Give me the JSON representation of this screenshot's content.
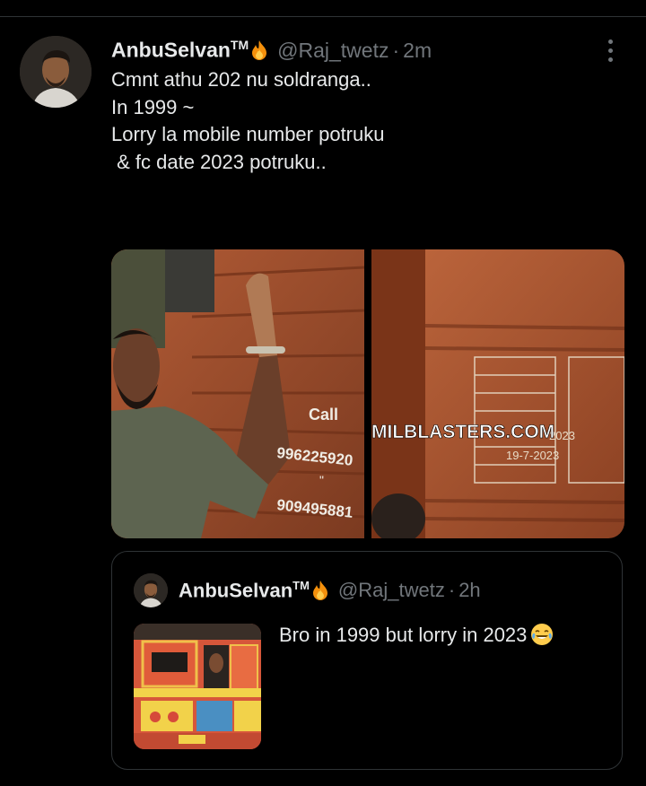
{
  "tweet": {
    "display_name": "AnbuSelvan",
    "trademark": "TM",
    "handle": "@Raj_twetz",
    "separator": "·",
    "time": "2m",
    "text_lines": [
      "Cmnt athu 202 nu soldranga..",
      "",
      "In 1999 ~",
      "",
      "Lorry la mobile number potruku",
      " & fc date 2023 potruku.."
    ],
    "icons": {
      "badge": "fire-emoji",
      "menu": "more-options-icon"
    }
  },
  "media": {
    "left_image": {
      "sign_lines": [
        "Call",
        "996225920",
        "\"",
        "909495881"
      ]
    },
    "right_image": {
      "watermark": "MILBLASTERS.COM",
      "plate_year": "2023",
      "plate_date": "19-7-2023"
    }
  },
  "quote": {
    "display_name": "AnbuSelvan",
    "trademark": "TM",
    "handle": "@Raj_twetz",
    "separator": "·",
    "time": "2h",
    "text": "Bro in 1999 but lorry in 2023",
    "emoji": "face-with-tears-of-joy-emoji"
  },
  "colors": {
    "background": "#000000",
    "text": "#e7e9ea",
    "muted": "#71767b",
    "border": "#2f3336"
  }
}
